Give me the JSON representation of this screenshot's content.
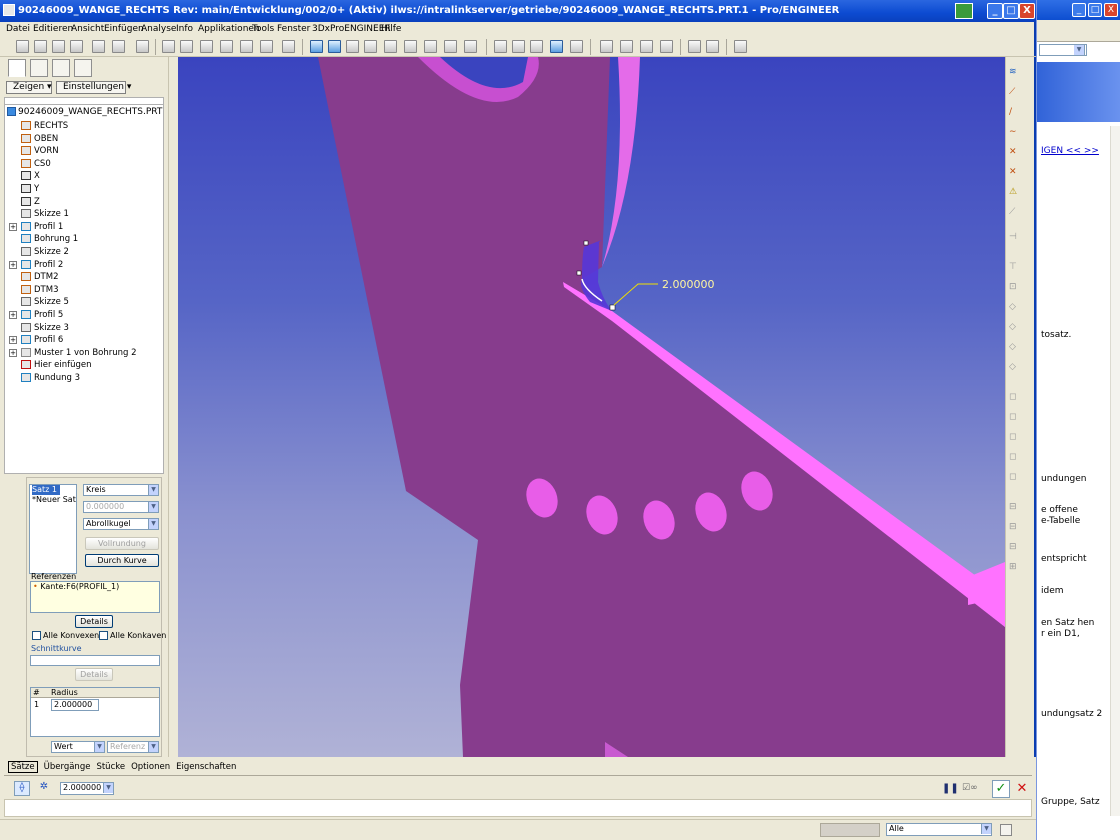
{
  "window": {
    "title": "90246009_WANGE_RECHTS Rev: main/Entwicklung/002/0+ (Aktiv) ilws://intralinkserver/getriebe/90246009_WANGE_RECHTS.PRT.1 - Pro/ENGINEER",
    "min_label": "_",
    "max_label": "□",
    "close_label": "X"
  },
  "menubar": [
    "Datei",
    "Editieren",
    "Ansicht",
    "Einfügen",
    "Analyse",
    "Info",
    "Applikationen",
    "Tools",
    "Fenster",
    "3DxProENGINEER",
    "Hilfe"
  ],
  "left_panel": {
    "show_button": "Zeigen ▾",
    "settings_button": "Einstellungen ▾",
    "tree_root": "90246009_WANGE_RECHTS.PRT",
    "tree_items": [
      {
        "label": "RECHTS",
        "icon": "datum-plane-icon",
        "expandable": false
      },
      {
        "label": "OBEN",
        "icon": "datum-plane-icon",
        "expandable": false
      },
      {
        "label": "VORN",
        "icon": "datum-plane-icon",
        "expandable": false
      },
      {
        "label": "CS0",
        "icon": "coordinate-system-icon",
        "expandable": false
      },
      {
        "label": "X",
        "icon": "datum-axis-icon",
        "expandable": false
      },
      {
        "label": "Y",
        "icon": "datum-axis-icon",
        "expandable": false
      },
      {
        "label": "Z",
        "icon": "datum-axis-icon",
        "expandable": false
      },
      {
        "label": "Skizze 1",
        "icon": "sketch-icon",
        "expandable": false
      },
      {
        "label": "Profil 1",
        "icon": "extrude-icon",
        "expandable": true
      },
      {
        "label": "Bohrung 1",
        "icon": "hole-icon",
        "expandable": false
      },
      {
        "label": "Skizze 2",
        "icon": "sketch-icon",
        "expandable": false
      },
      {
        "label": "Profil 2",
        "icon": "extrude-icon",
        "expandable": true
      },
      {
        "label": "DTM2",
        "icon": "datum-plane-icon",
        "expandable": false
      },
      {
        "label": "DTM3",
        "icon": "datum-plane-icon",
        "expandable": false
      },
      {
        "label": "Skizze 5",
        "icon": "sketch-icon",
        "expandable": false
      },
      {
        "label": "Profil 5",
        "icon": "extrude-icon",
        "expandable": true
      },
      {
        "label": "Skizze 3",
        "icon": "sketch-icon",
        "expandable": false
      },
      {
        "label": "Profil 6",
        "icon": "extrude-icon",
        "expandable": true
      },
      {
        "label": "Muster 1 von Bohrung 2",
        "icon": "pattern-icon",
        "expandable": true
      },
      {
        "label": "Hier einfügen",
        "icon": "insert-here-arrow-icon",
        "expandable": false
      },
      {
        "label": "Rundung 3",
        "icon": "round-icon",
        "expandable": false
      }
    ]
  },
  "round_panel": {
    "sets": [
      "Satz 1",
      "*Neuer Satz"
    ],
    "shape_select": "Kreis",
    "value_field": "0.000000",
    "method_select": "Abrollkugel",
    "extend_button": "Vollrundung",
    "through_curve_button": "Durch Kurve",
    "references_label": "Referenzen",
    "reference_item": "Kante:F6(PROFIL_1)",
    "details_button": "Details",
    "all_convex_label": "Alle Konvexen",
    "all_concave_label": "Alle Konkaven",
    "spine_label": "Schnittkurve",
    "spine_details_button": "Details",
    "radius_header_num": "#",
    "radius_header": "Radius",
    "radius_row_num": "1",
    "radius_row_value": "2.000000",
    "value_select": "Wert",
    "reference_select": "Referenz"
  },
  "graphics": {
    "dimension_label": "2.000000",
    "body_color": "#8a3d8f",
    "highlight_color": "#ff6fff",
    "round_color": "#5a3fd6"
  },
  "dashboard": {
    "tabs": [
      "Sätze",
      "Übergänge",
      "Stücke",
      "Optionen",
      "Eigenschaften"
    ],
    "radius_combo": "2.000000"
  },
  "status": {
    "filter_select": "Alle"
  },
  "background_window": {
    "lines": [
      "IGEN << >>",
      "tosatz.",
      "undungen",
      "e offene",
      "e-Tabelle",
      "entspricht",
      "idem",
      "en Satz hen",
      "r ein D1,",
      "undungsatz 2",
      "Gruppe, Satz"
    ]
  }
}
